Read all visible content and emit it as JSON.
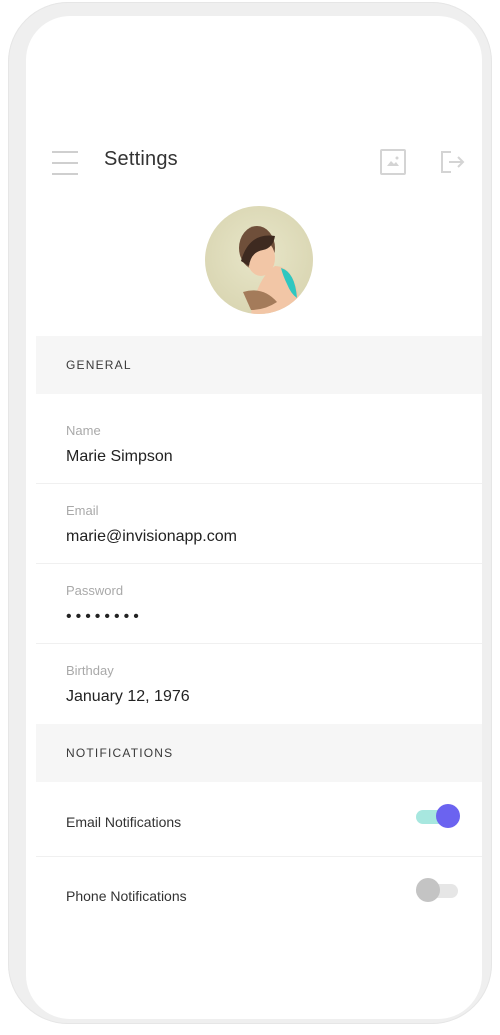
{
  "header": {
    "title": "Settings",
    "menu_icon": "hamburger-menu-icon",
    "image_icon": "image-icon",
    "logout_icon": "logout-icon"
  },
  "profile": {
    "avatar": "avatar"
  },
  "sections": {
    "general_label": "GENERAL",
    "notifications_label": "NOTIFICATIONS"
  },
  "fields": {
    "name": {
      "label": "Name",
      "value": "Marie Simpson"
    },
    "email": {
      "label": "Email",
      "value": "marie@invisionapp.com"
    },
    "password": {
      "label": "Password",
      "value": "••••••••"
    },
    "birthday": {
      "label": "Birthday",
      "value": "January 12, 1976"
    }
  },
  "notifications": {
    "email": {
      "label": "Email Notifications",
      "enabled": true
    },
    "phone": {
      "label": "Phone Notifications",
      "enabled": false
    }
  },
  "colors": {
    "toggle_on_track": "#a7e7df",
    "toggle_on_knob": "#6b63f0",
    "toggle_off_track": "#e6e6e6",
    "toggle_off_knob": "#c4c4c4"
  }
}
